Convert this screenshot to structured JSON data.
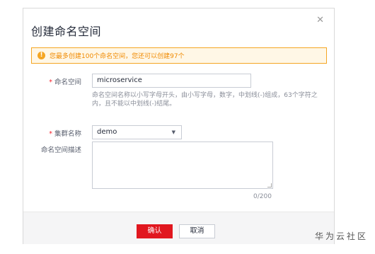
{
  "dialog": {
    "title": "创建命名空间",
    "close_icon": "close-icon"
  },
  "alert": {
    "icon": "info-icon",
    "text": "您最多创建100个命名空间，您还可以创建97个"
  },
  "form": {
    "namespace": {
      "required_mark": "*",
      "label": "命名空间",
      "value": "microservice",
      "hint": "命名空间名称以小写字母开头，由小写字母，数字，中划线(-)组成，63个字符之内，且不能以中划线(-)结尾。"
    },
    "cluster": {
      "required_mark": "*",
      "label": "集群名称",
      "value": "demo",
      "caret": "▼"
    },
    "description": {
      "label": "命名空间描述",
      "value": "",
      "counter": "0/200"
    }
  },
  "footer": {
    "confirm_label": "确认",
    "cancel_label": "取消"
  },
  "watermark": {
    "text": "华为云社区"
  },
  "colors": {
    "primary": "#e1171f",
    "warning": "#f5a623",
    "required": "#f5222d"
  }
}
